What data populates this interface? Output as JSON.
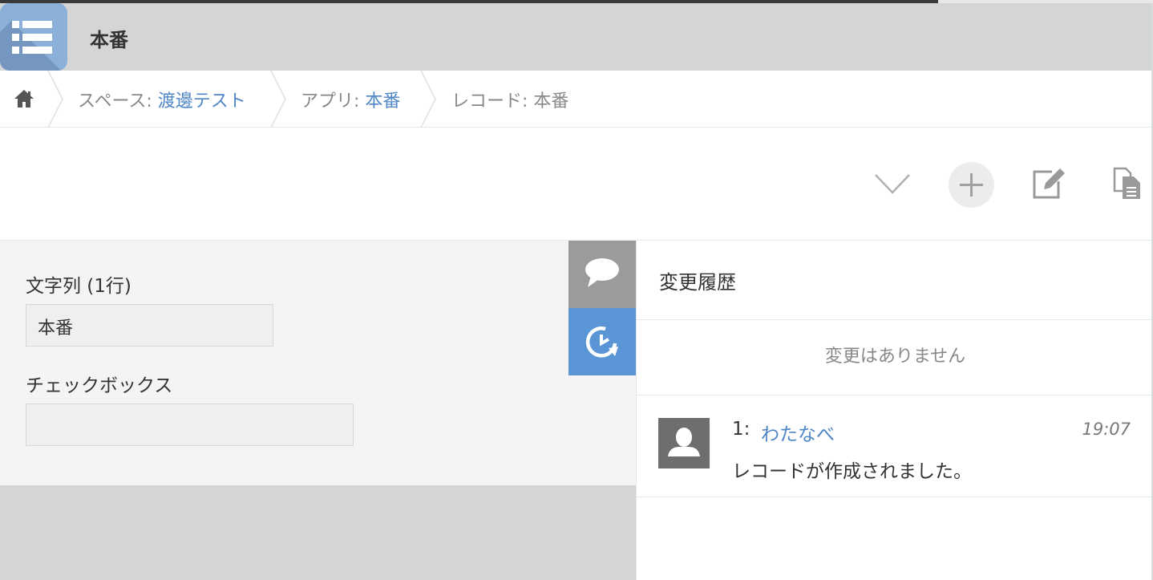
{
  "header": {
    "app_title": "本番"
  },
  "breadcrumb": {
    "space_prefix": "スペース:",
    "space_name": "渡邊テスト",
    "app_prefix": "アプリ:",
    "app_name": "本番",
    "record_text": "レコード: 本番"
  },
  "toolbar": {
    "icons": [
      "chevron-down-icon",
      "plus-icon",
      "edit-icon",
      "copy-record-icon"
    ]
  },
  "form": {
    "text_field_label": "文字列 (1行)",
    "text_field_value": "本番",
    "checkbox_label": "チェックボックス",
    "checkbox_value": ""
  },
  "history": {
    "title": "変更履歴",
    "empty_message": "変更はありません",
    "entries": [
      {
        "number": "1:",
        "user": "わたなべ",
        "time": "19:07",
        "message": "レコードが作成されました。"
      }
    ]
  },
  "colors": {
    "accent_blue": "#5a96d6",
    "link_blue": "#4f86c6",
    "header_gray": "#d4d6d5",
    "comment_tab_gray": "#9b9b9b",
    "app_icon_blue": "#8ab0d8"
  }
}
